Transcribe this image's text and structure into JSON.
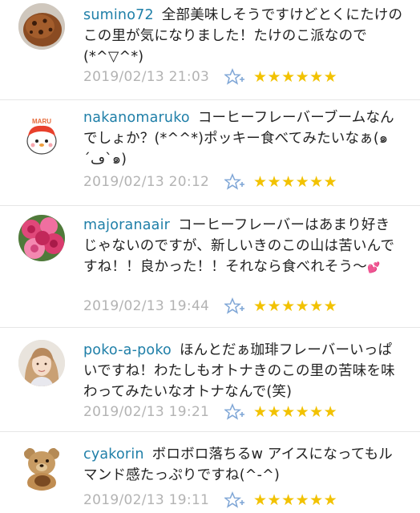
{
  "comments": [
    {
      "username": "sumino72",
      "text": "全部美味しそうですけどとくにたけのこの里が気になりました！たけのこ派なので(*^▽^*)",
      "timestamp": "2019/02/13 21:03",
      "stars": "★★★★★★",
      "avatar": "chocolate-cookie-avatar"
    },
    {
      "username": "nakanomaruko",
      "text": "コーヒーフレーバーブームなんでしょか？(*^^*)ポッキー食べてみたいなぁ(๑´ڡ`๑)",
      "timestamp": "2019/02/13 20:12",
      "stars": "★★★★★★",
      "avatar": "maru-character-avatar",
      "avatar_label": "MARU"
    },
    {
      "username": "majoranaair",
      "text": "コーヒーフレーバーはあまり好きじゃないのですが、新しいきのこの山は苦いんですね！！良かった！！それなら食べれそう〜",
      "emoji": "💕",
      "timestamp": "2019/02/13 19:44",
      "stars": "★★★★★★",
      "avatar": "pink-roses-avatar"
    },
    {
      "username": "poko-a-poko",
      "text": "ほんとだぁ珈琲フレーバーいっぱいですね！わたしもオトナきのこの里の苦味を味わってみたいなオトナなんで(笑)",
      "timestamp": "2019/02/13 19:21",
      "stars": "★★★★★★",
      "avatar": "woman-portrait-avatar"
    },
    {
      "username": "cyakorin",
      "text": "ボロボロ落ちるw アイスになってもルマンド感たっぷりですね(^-^)",
      "timestamp": "2019/02/13 19:11",
      "stars": "★★★★★★",
      "avatar": "teddy-bear-avatar"
    }
  ],
  "colors": {
    "username": "#1f7fa8",
    "text": "#222222",
    "timestamp": "#b3b3b3",
    "star": "#f2c200",
    "add_star_icon": "#7fa6d6"
  }
}
